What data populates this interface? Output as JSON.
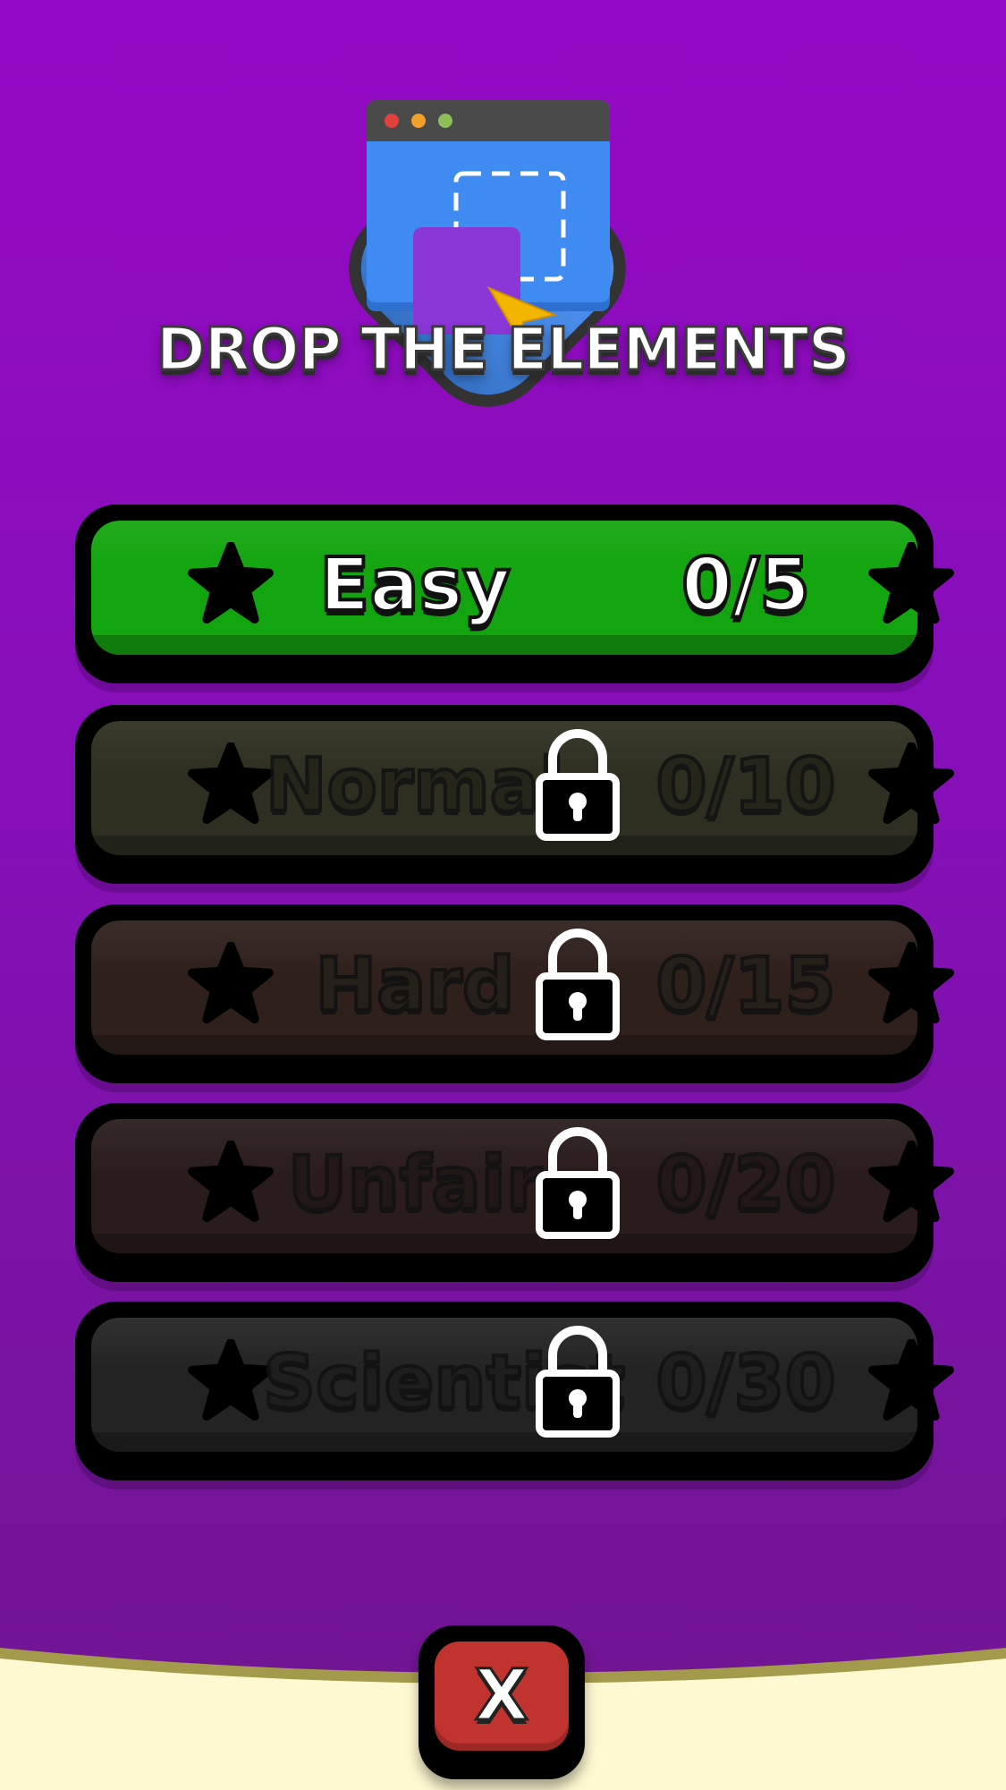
{
  "screen": {
    "title": "DROP THE ELEMENTS",
    "close_label": "X"
  },
  "levels": [
    {
      "name": "Easy",
      "progress": "0/5",
      "locked": false,
      "bg": "#13a50f",
      "text_color": "#ffffff"
    },
    {
      "name": "Normal",
      "progress": "0/10",
      "locked": true,
      "bg": "#2e2f20",
      "text_color": "#242419"
    },
    {
      "name": "Hard",
      "progress": "0/15",
      "locked": true,
      "bg": "#2f201c",
      "text_color": "#242019"
    },
    {
      "name": "Unfair",
      "progress": "0/20",
      "locked": true,
      "bg": "#2a1c1c",
      "text_color": "#221818"
    },
    {
      "name": "Scientist",
      "progress": "0/30",
      "locked": true,
      "bg": "#232323",
      "text_color": "#1e1e1e"
    }
  ],
  "colors": {
    "background_top": "#9409c4",
    "background_bottom": "#6f1690",
    "ground": "#fff9d2",
    "ground_edge": "#a39a4b",
    "close_button": "#c0332f",
    "logo_blue": "#3f89f0",
    "logo_purple": "#8b36d6",
    "cursor_yellow": "#f2b600"
  },
  "icons": {
    "logo": "browser-window-drag-icon",
    "star": "star-icon",
    "lock": "padlock-icon"
  }
}
